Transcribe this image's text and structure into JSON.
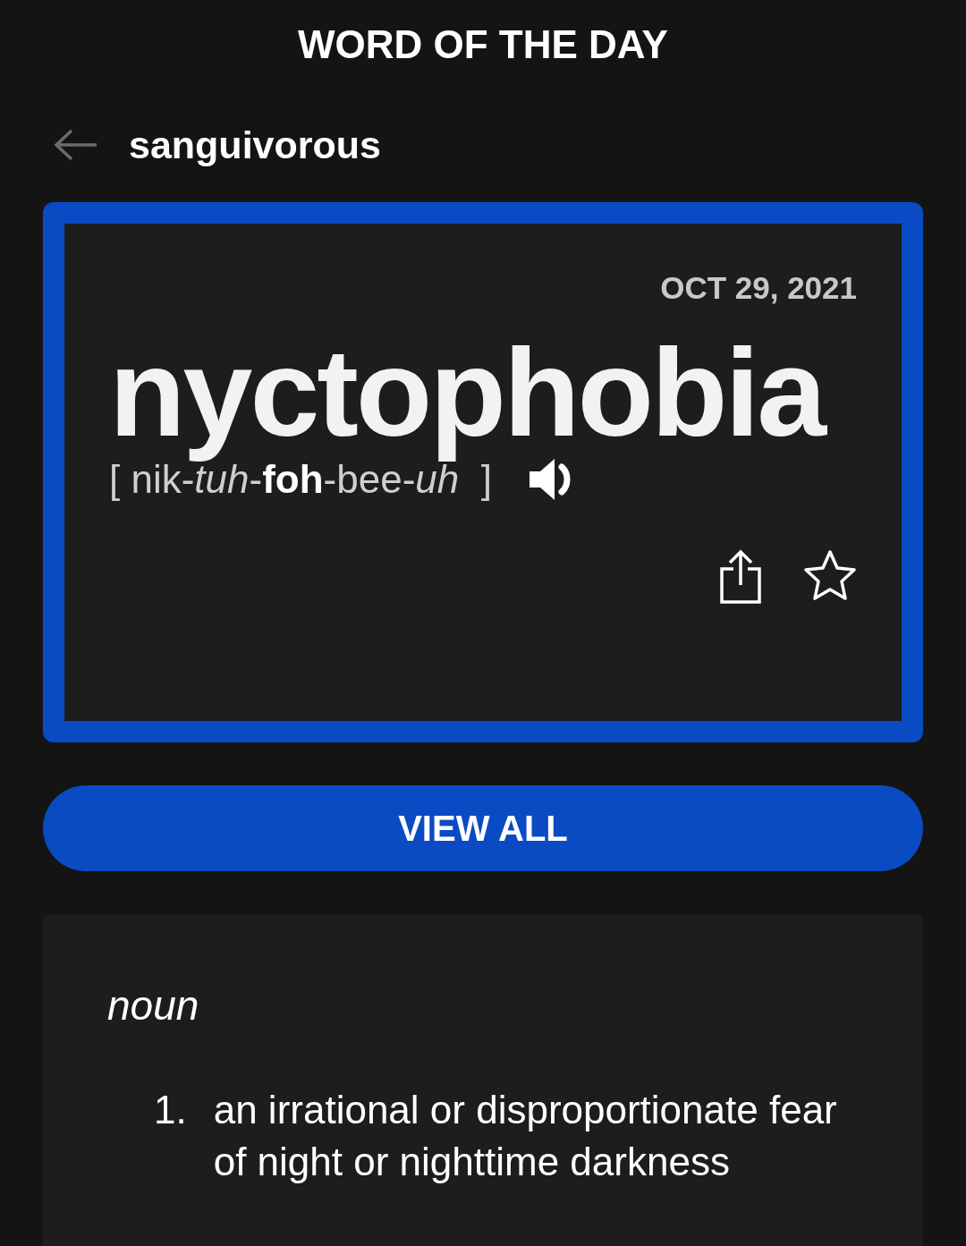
{
  "header": {
    "title": "WORD OF THE DAY"
  },
  "nav": {
    "previous_word": "sanguivorous"
  },
  "word_card": {
    "date": "OCT 29, 2021",
    "word": "nyctophobia",
    "pronunciation": "[ nik-*tuh*-**foh**-bee-*uh*  ]",
    "favorite": false
  },
  "view_all_button": "VIEW ALL",
  "definition": {
    "part_of_speech": "noun",
    "senses": [
      {
        "number": "1.",
        "text": "an irrational or disproportionate fear of night or nighttime darkness"
      }
    ]
  }
}
